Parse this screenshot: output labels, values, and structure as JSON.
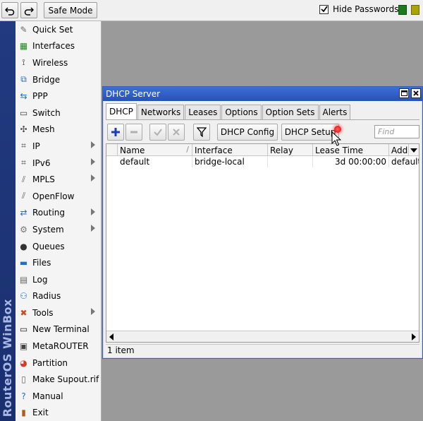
{
  "toolbar": {
    "safe_mode_label": "Safe Mode",
    "hide_passwords_label": "Hide Passwords",
    "hide_passwords_checked": true,
    "undo_icon": "undo-icon",
    "redo_icon": "redo-icon"
  },
  "brand": {
    "text": "RouterOS WinBox"
  },
  "sidebar": {
    "items": [
      {
        "label": "Quick Set",
        "icon": "quick-set-icon",
        "glyph": "✎",
        "color": "#666",
        "submenu": false
      },
      {
        "label": "Interfaces",
        "icon": "interfaces-icon",
        "glyph": "▦",
        "color": "#1e8a1e",
        "submenu": false
      },
      {
        "label": "Wireless",
        "icon": "wireless-icon",
        "glyph": "⟟",
        "color": "#333",
        "submenu": false
      },
      {
        "label": "Bridge",
        "icon": "bridge-icon",
        "glyph": "⧉",
        "color": "#1f6fc4",
        "submenu": false
      },
      {
        "label": "PPP",
        "icon": "ppp-icon",
        "glyph": "⇆",
        "color": "#1f6fc4",
        "submenu": false
      },
      {
        "label": "Switch",
        "icon": "switch-icon",
        "glyph": "▭",
        "color": "#444",
        "submenu": false
      },
      {
        "label": "Mesh",
        "icon": "mesh-icon",
        "glyph": "✣",
        "color": "#444",
        "submenu": false
      },
      {
        "label": "IP",
        "icon": "ip-icon",
        "glyph": "⌗",
        "color": "#444",
        "submenu": true
      },
      {
        "label": "IPv6",
        "icon": "ipv6-icon",
        "glyph": "⌗",
        "color": "#444",
        "submenu": true
      },
      {
        "label": "MPLS",
        "icon": "mpls-icon",
        "glyph": "⫽",
        "color": "#666",
        "submenu": true
      },
      {
        "label": "OpenFlow",
        "icon": "openflow-icon",
        "glyph": "⫽",
        "color": "#666",
        "submenu": false
      },
      {
        "label": "Routing",
        "icon": "routing-icon",
        "glyph": "⇄",
        "color": "#1f6fc4",
        "submenu": true
      },
      {
        "label": "System",
        "icon": "system-icon",
        "glyph": "⚙",
        "color": "#777",
        "submenu": true
      },
      {
        "label": "Queues",
        "icon": "queues-icon",
        "glyph": "●",
        "color": "#333",
        "submenu": false
      },
      {
        "label": "Files",
        "icon": "files-icon",
        "glyph": "▬",
        "color": "#1f6fc4",
        "submenu": false
      },
      {
        "label": "Log",
        "icon": "log-icon",
        "glyph": "▤",
        "color": "#666",
        "submenu": false
      },
      {
        "label": "Radius",
        "icon": "radius-icon",
        "glyph": "⚇",
        "color": "#1f6fc4",
        "submenu": false
      },
      {
        "label": "Tools",
        "icon": "tools-icon",
        "glyph": "✖",
        "color": "#c24d1f",
        "submenu": true
      },
      {
        "label": "New Terminal",
        "icon": "terminal-icon",
        "glyph": "▭",
        "color": "#222",
        "submenu": false
      },
      {
        "label": "MetaROUTER",
        "icon": "metarouter-icon",
        "glyph": "▣",
        "color": "#444",
        "submenu": false
      },
      {
        "label": "Partition",
        "icon": "partition-icon",
        "glyph": "◕",
        "color": "#d63a2a",
        "submenu": false
      },
      {
        "label": "Make Supout.rif",
        "icon": "make-supout-icon",
        "glyph": "▯",
        "color": "#666",
        "submenu": false
      },
      {
        "label": "Manual",
        "icon": "manual-icon",
        "glyph": "?",
        "color": "#1f6fc4",
        "submenu": false
      },
      {
        "label": "Exit",
        "icon": "exit-icon",
        "glyph": "▮",
        "color": "#b55a1a",
        "submenu": false
      }
    ]
  },
  "window": {
    "title": "DHCP Server",
    "tabs": [
      {
        "label": "DHCP",
        "active": true
      },
      {
        "label": "Networks",
        "active": false
      },
      {
        "label": "Leases",
        "active": false
      },
      {
        "label": "Options",
        "active": false
      },
      {
        "label": "Option Sets",
        "active": false
      },
      {
        "label": "Alerts",
        "active": false
      }
    ],
    "toolbar": {
      "dhcp_config_label": "DHCP Config",
      "dhcp_setup_label": "DHCP Setup",
      "find_placeholder": "Find"
    },
    "table": {
      "columns": [
        "Name",
        "Interface",
        "Relay",
        "Lease Time",
        "Addr"
      ],
      "rows": [
        {
          "name": "default",
          "interface": "bridge-local",
          "relay": "",
          "lease_time": "3d 00:00:00",
          "addr": "default-d"
        }
      ]
    },
    "status": "1 item"
  }
}
